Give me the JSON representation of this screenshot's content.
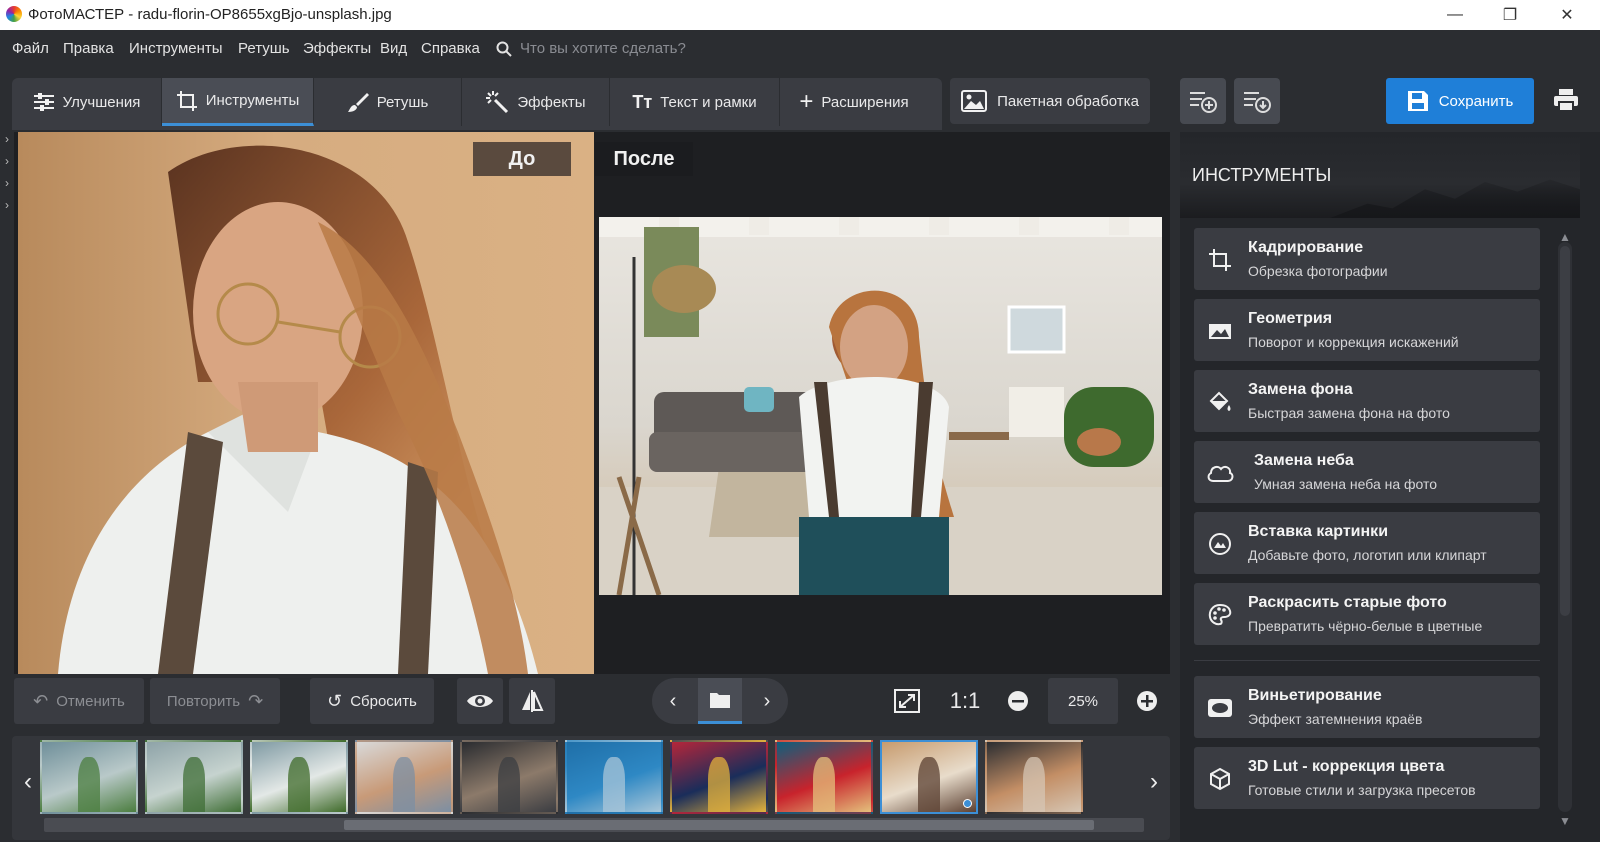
{
  "window": {
    "title": "ФотоМАСТЕР - radu-florin-OP8655xgBjo-unsplash.jpg",
    "minimize": "—",
    "restore": "❐",
    "close": "✕"
  },
  "menu": {
    "items": [
      "Файл",
      "Правка",
      "Инструменты",
      "Ретушь",
      "Эффекты",
      "Вид",
      "Справка"
    ],
    "search_placeholder": "Что вы хотите сделать?"
  },
  "tabs": [
    {
      "label": "Улучшения",
      "icon": "sliders-icon",
      "active": false
    },
    {
      "label": "Инструменты",
      "icon": "crop-icon",
      "active": true
    },
    {
      "label": "Ретушь",
      "icon": "brush-icon",
      "active": false
    },
    {
      "label": "Эффекты",
      "icon": "magic-wand-icon",
      "active": false
    },
    {
      "label": "Текст и рамки",
      "icon": "text-icon",
      "active": false
    },
    {
      "label": "Расширения",
      "icon": "plus-icon",
      "active": false
    }
  ],
  "batch_button": "Пакетная обработка",
  "save_button": "Сохранить",
  "preview": {
    "before_label": "До",
    "after_label": "После"
  },
  "bottom": {
    "undo": "Отменить",
    "redo": "Повторить",
    "reset": "Сбросить",
    "zoom_1to1": "1:1",
    "zoom_value": "25%"
  },
  "panel": {
    "header": "ИНСТРУМЕНТЫ",
    "tools": [
      {
        "title": "Кадрирование",
        "subtitle": "Обрезка фотографии",
        "icon": "crop-icon"
      },
      {
        "title": "Геометрия",
        "subtitle": "Поворот и коррекция искажений",
        "icon": "geometry-icon"
      },
      {
        "title": "Замена фона",
        "subtitle": "Быстрая замена фона на фото",
        "icon": "paint-bucket-icon"
      },
      {
        "title": "Замена неба",
        "subtitle": "Умная замена неба на фото",
        "icon": "cloud-icon"
      },
      {
        "title": "Вставка картинки",
        "subtitle": "Добавьте фото, логотип или клипарт",
        "icon": "insert-image-icon"
      },
      {
        "title": "Раскрасить старые фото",
        "subtitle": "Превратить чёрно-белые в цветные",
        "icon": "palette-icon"
      },
      {
        "title": "Виньетирование",
        "subtitle": "Эффект затемнения краёв",
        "icon": "vignette-icon"
      },
      {
        "title": "3D Lut - коррекция цвета",
        "subtitle": "Готовые стили и загрузка пресетов",
        "icon": "cube-icon"
      }
    ]
  },
  "filmstrip": {
    "thumbnails": [
      {
        "name": "greenhouse-1",
        "colors": [
          "#6f8f9a",
          "#b9c9c9",
          "#4b7d3f"
        ]
      },
      {
        "name": "greenhouse-2",
        "colors": [
          "#8ea3a8",
          "#c6d3cf",
          "#3f6e35"
        ]
      },
      {
        "name": "greenhouse-3",
        "colors": [
          "#7f9aa3",
          "#e3e8e6",
          "#3f6b2a"
        ]
      },
      {
        "name": "editor-screenshot-1",
        "colors": [
          "#d9d9d9",
          "#c89a78",
          "#7c8fa3"
        ]
      },
      {
        "name": "editor-screenshot-2",
        "colors": [
          "#2a2c30",
          "#8c7a6a",
          "#3b3d42"
        ]
      },
      {
        "name": "blue-hoodie",
        "colors": [
          "#1f6fa8",
          "#2e88c4",
          "#a9c6d8"
        ]
      },
      {
        "name": "colorful-woman",
        "colors": [
          "#b5263a",
          "#1a2d5a",
          "#e3b23c"
        ]
      },
      {
        "name": "red-shirt",
        "colors": [
          "#0d5f7d",
          "#c8232c",
          "#e4c07c"
        ]
      },
      {
        "name": "current-photo",
        "colors": [
          "#c79b6e",
          "#e8dccb",
          "#5b4032"
        ]
      },
      {
        "name": "editor-screenshot-3",
        "colors": [
          "#2b2d31",
          "#c38e65",
          "#d6c6b4"
        ]
      }
    ],
    "selected_index": 8
  }
}
